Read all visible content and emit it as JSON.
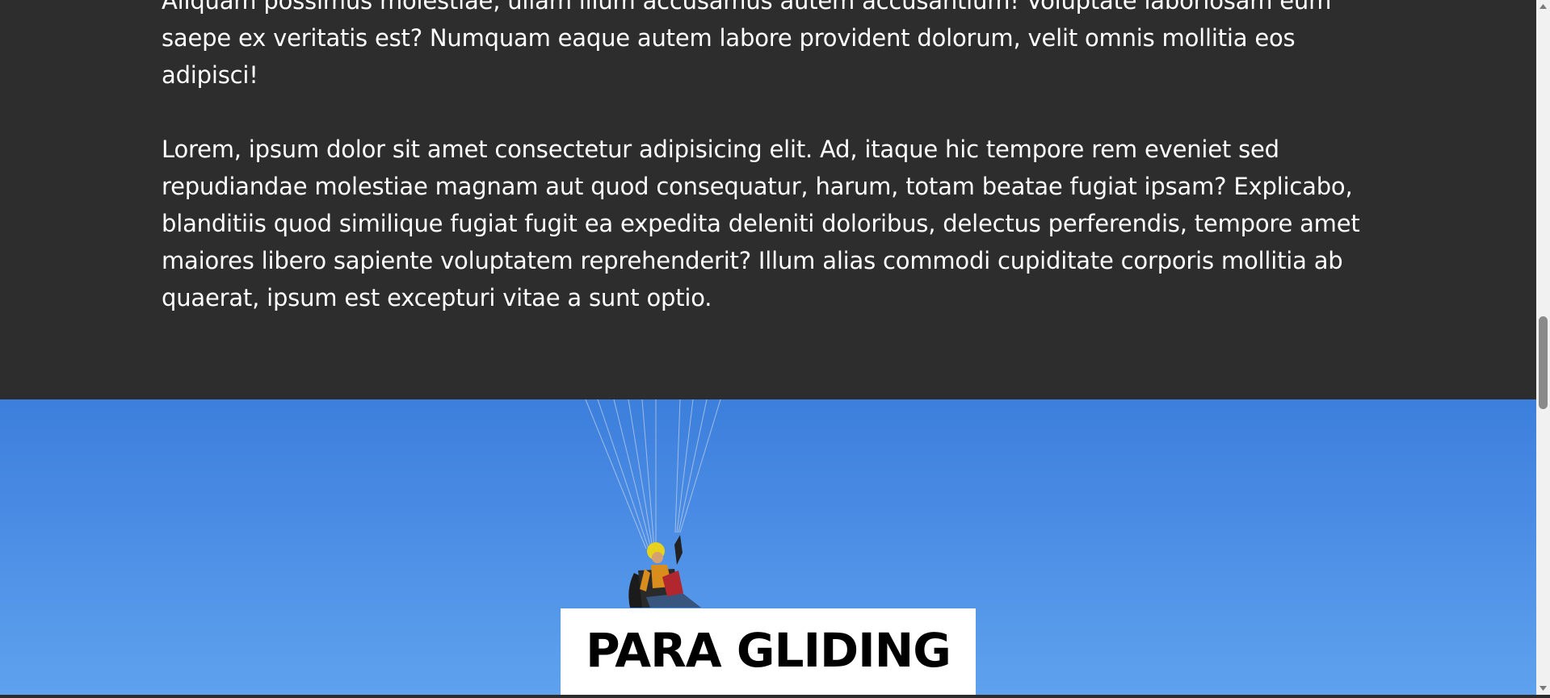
{
  "article": {
    "paragraph_1": "Aliquam possimus molestiae, ullam illum accusamus autem accusantium! Voluptate laboriosam eum saepe ex veritatis est? Numquam eaque autem labore provident dolorum, velit omnis mollitia eos adipisci!",
    "paragraph_2": "Lorem, ipsum dolor sit amet consectetur adipisicing elit. Ad, itaque hic tempore rem eveniet sed repudiandae molestiae magnam aut quod consequatur, harum, totam beatae fugiat ipsam? Explicabo, blanditiis quod similique fugiat fugit ea expedita deleniti doloribus, delectus perferendis, tempore amet maiores libero sapiente voluptatem reprehenderit? Illum alias commodi cupiditate corporis mollitia ab quaerat, ipsum est excepturi vitae a sunt optio."
  },
  "hero": {
    "title": "PARA GLIDING",
    "image_subject": "paraglider against blue sky"
  },
  "colors": {
    "dark_background": "#2d2d2d",
    "sky_blue": "#4a8ce4",
    "text_light": "#ffffff",
    "title_box": "#ffffff",
    "title_text": "#000000"
  },
  "scrollbar": {
    "up_icon": "triangle-up-icon",
    "down_icon": "triangle-down-icon"
  }
}
